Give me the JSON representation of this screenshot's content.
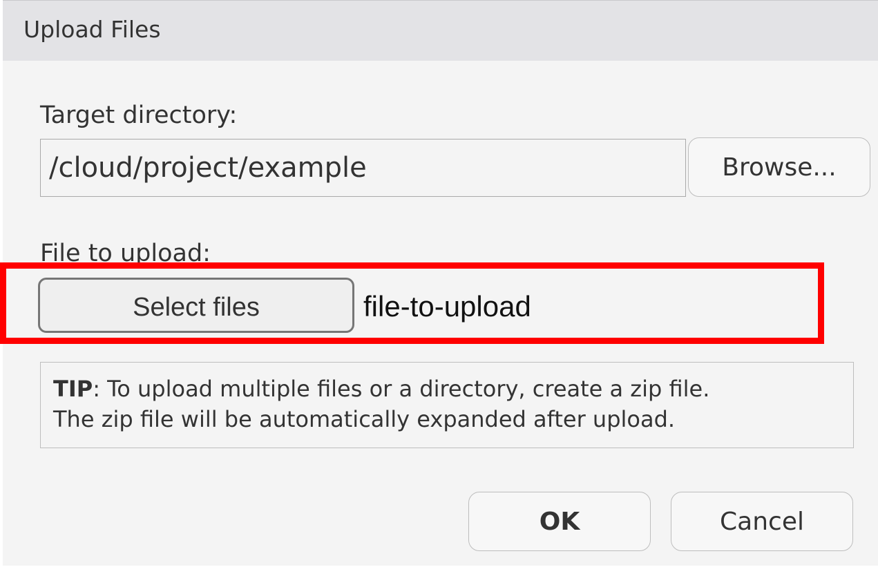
{
  "dialog": {
    "title": "Upload Files"
  },
  "target_directory": {
    "label": "Target directory:",
    "value": "/cloud/project/example",
    "browse_label": "Browse..."
  },
  "file_upload": {
    "label": "File to upload:",
    "select_label": "Select files",
    "file_name": "file-to-upload"
  },
  "tip": {
    "prefix": "TIP",
    "line1_rest": ": To upload multiple files or a directory, create a zip file.",
    "line2": "The zip file will be automatically expanded after upload."
  },
  "actions": {
    "ok_label": "OK",
    "cancel_label": "Cancel"
  },
  "colors": {
    "highlight": "#ff0000",
    "titlebar": "#e3e3e6",
    "dialog_bg": "#f4f4f4"
  }
}
